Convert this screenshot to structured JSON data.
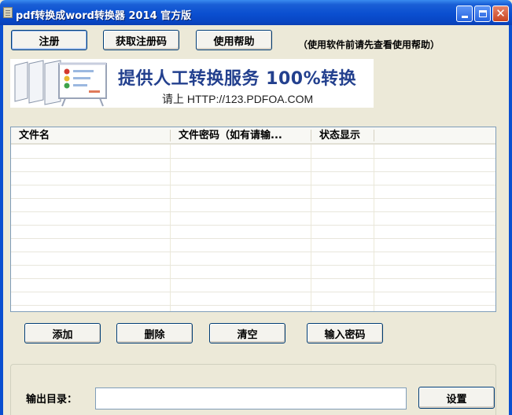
{
  "window": {
    "title": "pdf转换成word转换器 2014 官方版",
    "minimize_glyph": "",
    "maximize_glyph": "",
    "close_glyph": "✕"
  },
  "toolbar": {
    "register_label": "注册",
    "get_code_label": "获取注册码",
    "help_label": "使用帮助",
    "hint": "（使用软件前请先查看使用帮助）"
  },
  "banner": {
    "headline": "提供人工转换服务 100%转换",
    "subline": "请上  HTTP://123.PDFOA.COM",
    "headline_color": "#23408e"
  },
  "file_list": {
    "columns": [
      "文件名",
      "文件密码（如有请输...",
      "状态显示"
    ],
    "rows": []
  },
  "actions": {
    "add_label": "添加",
    "delete_label": "删除",
    "clear_label": "清空",
    "password_label": "输入密码"
  },
  "output": {
    "label": "输出目录：",
    "value": "",
    "settings_label": "设置"
  },
  "colors": {
    "titlebar": "#0a4fd0",
    "window_bg": "#ece9d8",
    "button_border": "#003c74"
  }
}
